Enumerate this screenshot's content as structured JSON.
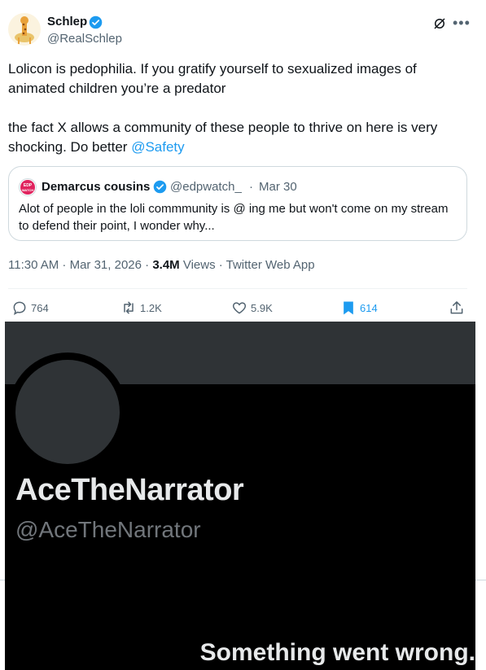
{
  "tweet": {
    "author_name": "Schlep",
    "author_handle": "@RealSchlep",
    "paragraph1": "Lolicon is pedophilia. If you gratify yourself to sexualized images of animated children you’re a predator",
    "paragraph2_prefix": "the fact X allows a community of these people to thrive on here is very shocking. Do better ",
    "mention": "@Safety",
    "quote": {
      "name": "Demarcus cousins",
      "handle": "@edpwatch_",
      "dot": "·",
      "date": "Mar 30",
      "text": "Alot of people in the loli commmunity is @ ing me but won't come on my stream to defend their point, I wonder why...",
      "avatar_text": "EDP WATCH"
    },
    "time": "11:30 AM · Mar 31, 2026 · ",
    "views_count": "3.4M",
    "views_suffix": " Views · Twitter Web App",
    "actions": {
      "replies": "764",
      "reposts": "1.2K",
      "likes": "5.9K",
      "bookmarks": "614"
    },
    "accent_color": "#1d9bf0"
  },
  "media": {
    "profile_name": "AceTheNarrator",
    "profile_handle": "@AceTheNarrator",
    "error_text": "Something went wrong."
  }
}
